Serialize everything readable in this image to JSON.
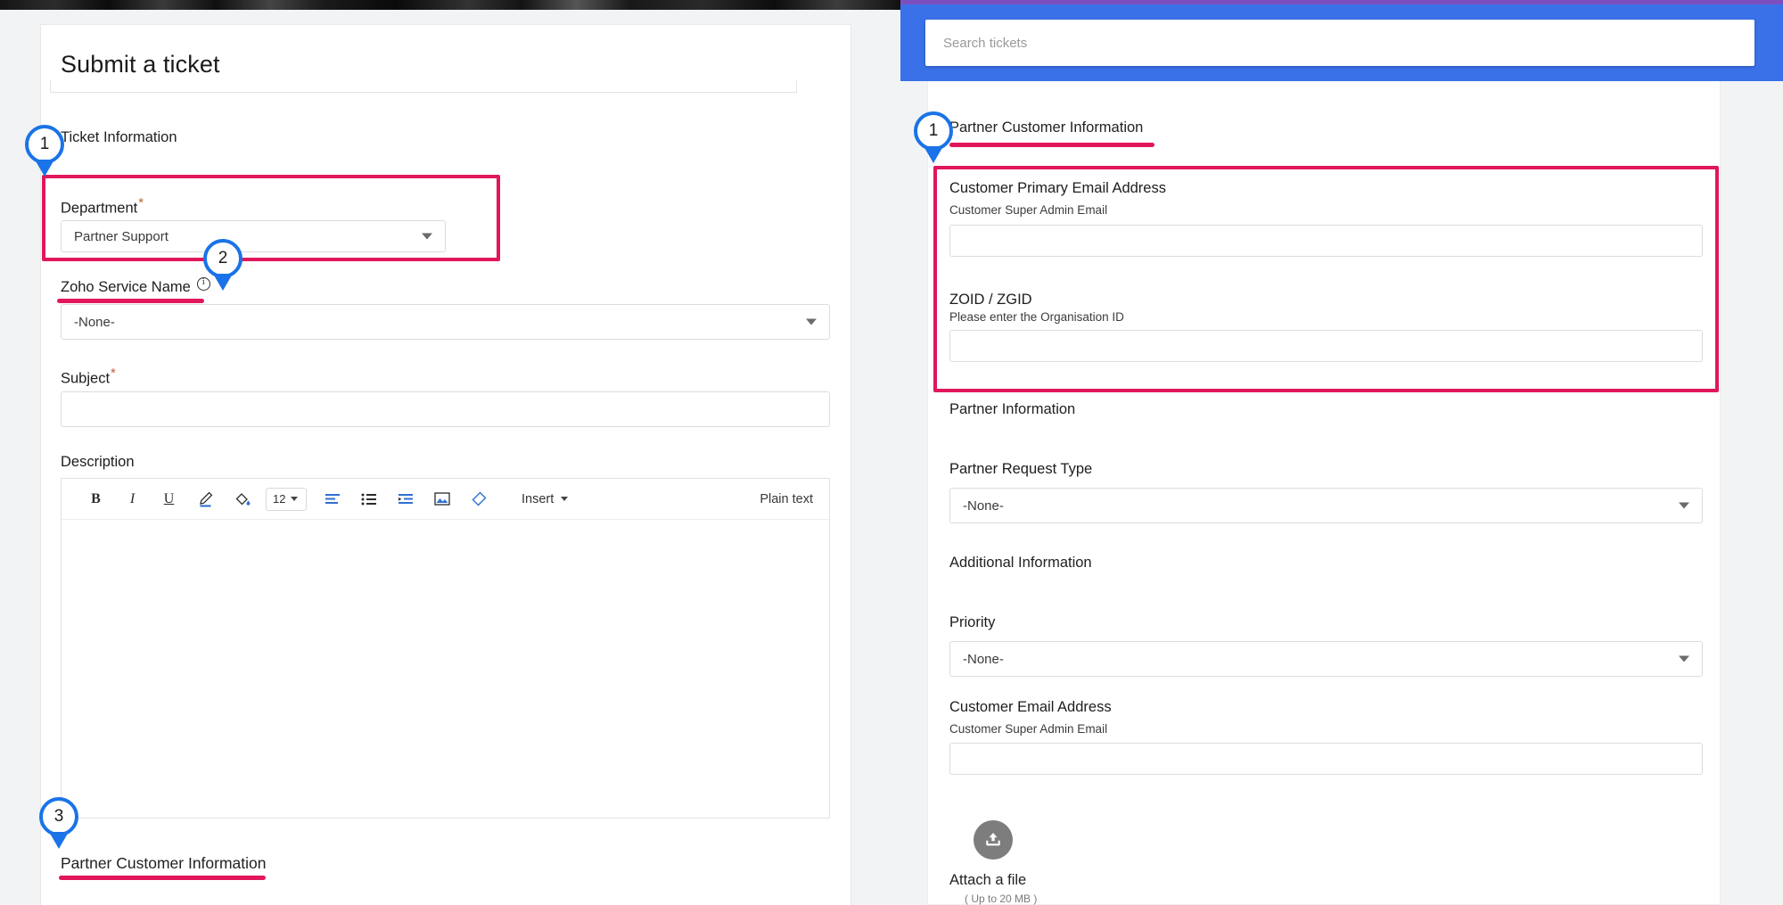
{
  "left_panel": {
    "page_title": "Submit a ticket",
    "section_ticket_information": "Ticket Information",
    "department": {
      "label": "Department",
      "required_marker": "*",
      "value": "Partner Support"
    },
    "zoho_service_name": {
      "label": "Zoho Service Name",
      "info_icon": "info-circle-icon",
      "value": "-None-"
    },
    "subject": {
      "label": "Subject",
      "required_marker": "*",
      "value": ""
    },
    "description": {
      "label": "Description",
      "toolbar": {
        "bold": "B",
        "italic": "I",
        "underline": "U",
        "text_color": "pen-icon",
        "background_color": "paint-bucket-icon",
        "font_size": "12",
        "align": "align-left-icon",
        "bulleted_list": "bulleted-list-icon",
        "indent": "indent-icon",
        "image": "image-icon",
        "clear_format": "eraser-icon",
        "insert": "Insert",
        "plain_text": "Plain text"
      },
      "body_value": ""
    },
    "section_partner_customer_information": "Partner Customer Information"
  },
  "right_panel": {
    "search": {
      "placeholder": "Search tickets",
      "value": ""
    },
    "section_partner_customer_information": "Partner Customer Information",
    "customer_primary_email": {
      "label": "Customer Primary Email Address",
      "hint": "Customer Super Admin Email",
      "value": ""
    },
    "zoid_zgid": {
      "label": "ZOID / ZGID",
      "hint": "Please enter the Organisation ID",
      "value": ""
    },
    "section_partner_information": "Partner Information",
    "partner_request_type": {
      "label": "Partner Request Type",
      "value": "-None-"
    },
    "section_additional_information": "Additional Information",
    "priority": {
      "label": "Priority",
      "value": "-None-"
    },
    "customer_email_address": {
      "label": "Customer Email Address",
      "hint": "Customer Super Admin Email",
      "value": ""
    },
    "attach": {
      "icon": "upload-icon",
      "label": "Attach a file",
      "note": "( Up to 20 MB )"
    }
  },
  "annotations": {
    "pin_1_left": "1",
    "pin_2_left": "2",
    "pin_3_left": "3",
    "pin_1_right": "1",
    "highlight_color": "#e1175b",
    "pin_color": "#1a73e8"
  }
}
